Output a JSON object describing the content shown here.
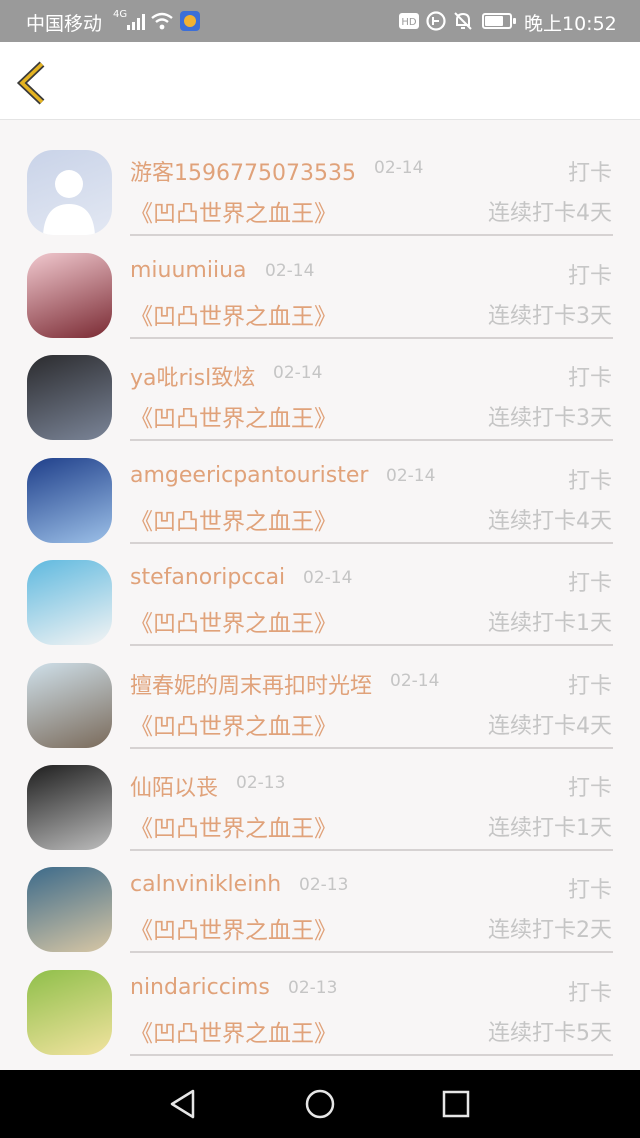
{
  "status_bar": {
    "carrier": "中国移动",
    "network": "4G",
    "time": "晚上10:52",
    "battery_level": 0.8
  },
  "header": {
    "back_icon": "chevron-left-icon",
    "accent_color": "#e4b322"
  },
  "colors": {
    "name_text": "#e0a27a",
    "meta_text": "#c5c5c5"
  },
  "checkins": [
    {
      "name": "",
      "date": "",
      "action": "",
      "book": "",
      "streak": ""
    },
    {
      "name": "游客1596775073535",
      "date": "02-14",
      "action": "打卡",
      "book": "《凹凸世界之血王》",
      "streak": "连续打卡4天"
    },
    {
      "name": "miuumiiua",
      "date": "02-14",
      "action": "打卡",
      "book": "《凹凸世界之血王》",
      "streak": "连续打卡3天"
    },
    {
      "name": "ya吡risl致炫",
      "date": "02-14",
      "action": "打卡",
      "book": "《凹凸世界之血王》",
      "streak": "连续打卡3天"
    },
    {
      "name": "amgeericpantourister",
      "date": "02-14",
      "action": "打卡",
      "book": "《凹凸世界之血王》",
      "streak": "连续打卡4天"
    },
    {
      "name": "stefanoripccai",
      "date": "02-14",
      "action": "打卡",
      "book": "《凹凸世界之血王》",
      "streak": "连续打卡1天"
    },
    {
      "name": "擅春妮的周末再扣时光垤",
      "date": "02-14",
      "action": "打卡",
      "book": "《凹凸世界之血王》",
      "streak": "连续打卡4天"
    },
    {
      "name": "仙陌以丧",
      "date": "02-13",
      "action": "打卡",
      "book": "《凹凸世界之血王》",
      "streak": "连续打卡1天"
    },
    {
      "name": "calnvinikleinh",
      "date": "02-13",
      "action": "打卡",
      "book": "《凹凸世界之血王》",
      "streak": "连续打卡2天"
    },
    {
      "name": "nindariccims",
      "date": "02-13",
      "action": "打卡",
      "book": "《凹凸世界之血王》",
      "streak": "连续打卡5天"
    }
  ],
  "nav_bar": {
    "back": "nav-back-icon",
    "home": "nav-home-icon",
    "recents": "nav-recents-icon"
  }
}
